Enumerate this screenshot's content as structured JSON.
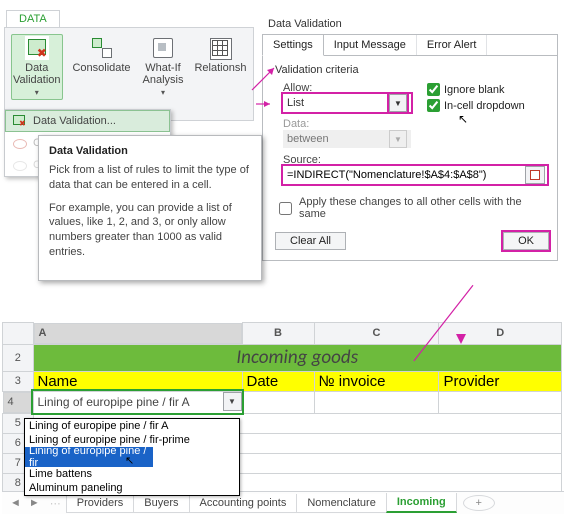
{
  "ribbon": {
    "tab": "DATA",
    "buttons": {
      "data_validation": "Data Validation",
      "consolidate": "Consolidate",
      "what_if": "What-If Analysis",
      "relationships": "Relationsh"
    },
    "dv_menu": {
      "item1": "Data Validation...",
      "item2": "Circle Invalid Data",
      "item3": "Clear Validation Circles"
    }
  },
  "tooltip": {
    "title": "Data Validation",
    "p1": "Pick from a list of rules to limit the type of data that can be entered in a cell.",
    "p2": "For example, you can provide a list of values, like 1, 2, and 3, or only allow numbers greater than 1000 as valid entries."
  },
  "dialog": {
    "title": "Data Validation",
    "tabs": {
      "settings": "Settings",
      "input": "Input Message",
      "error": "Error Alert"
    },
    "group": "Validation criteria",
    "allow_label": "Allow:",
    "allow_value": "List",
    "data_label": "Data:",
    "data_value": "between",
    "ignore_blank": "Ignore blank",
    "incell_dd": "In-cell dropdown",
    "source_label": "Source:",
    "source_value": "=INDIRECT(\"Nomenclature!$A$4:$A$8\")",
    "apply_label": "Apply these changes to all other cells with the same",
    "clear": "Clear All",
    "ok": "OK"
  },
  "sheet": {
    "cols": {
      "A": "A",
      "B": "B",
      "C": "C",
      "D": "D"
    },
    "title": "Incoming goods",
    "headers": {
      "name": "Name",
      "date": "Date",
      "invoice": "№ invoice",
      "provider": "Provider"
    },
    "cell_a4": "Lining of europipe pine / fir A",
    "dropdown": {
      "o1": "Lining of europipe pine / fir A",
      "o2": "Lining of europipe pine / fir-prime",
      "o3": "Lining of europipe pine / fir",
      "o4": "Lime battens",
      "o5": "Aluminum paneling"
    }
  },
  "tabs": {
    "providers": "Providers",
    "buyers": "Buyers",
    "accounting": "Accounting points",
    "nomenclature": "Nomenclature",
    "incoming": "Incoming"
  }
}
